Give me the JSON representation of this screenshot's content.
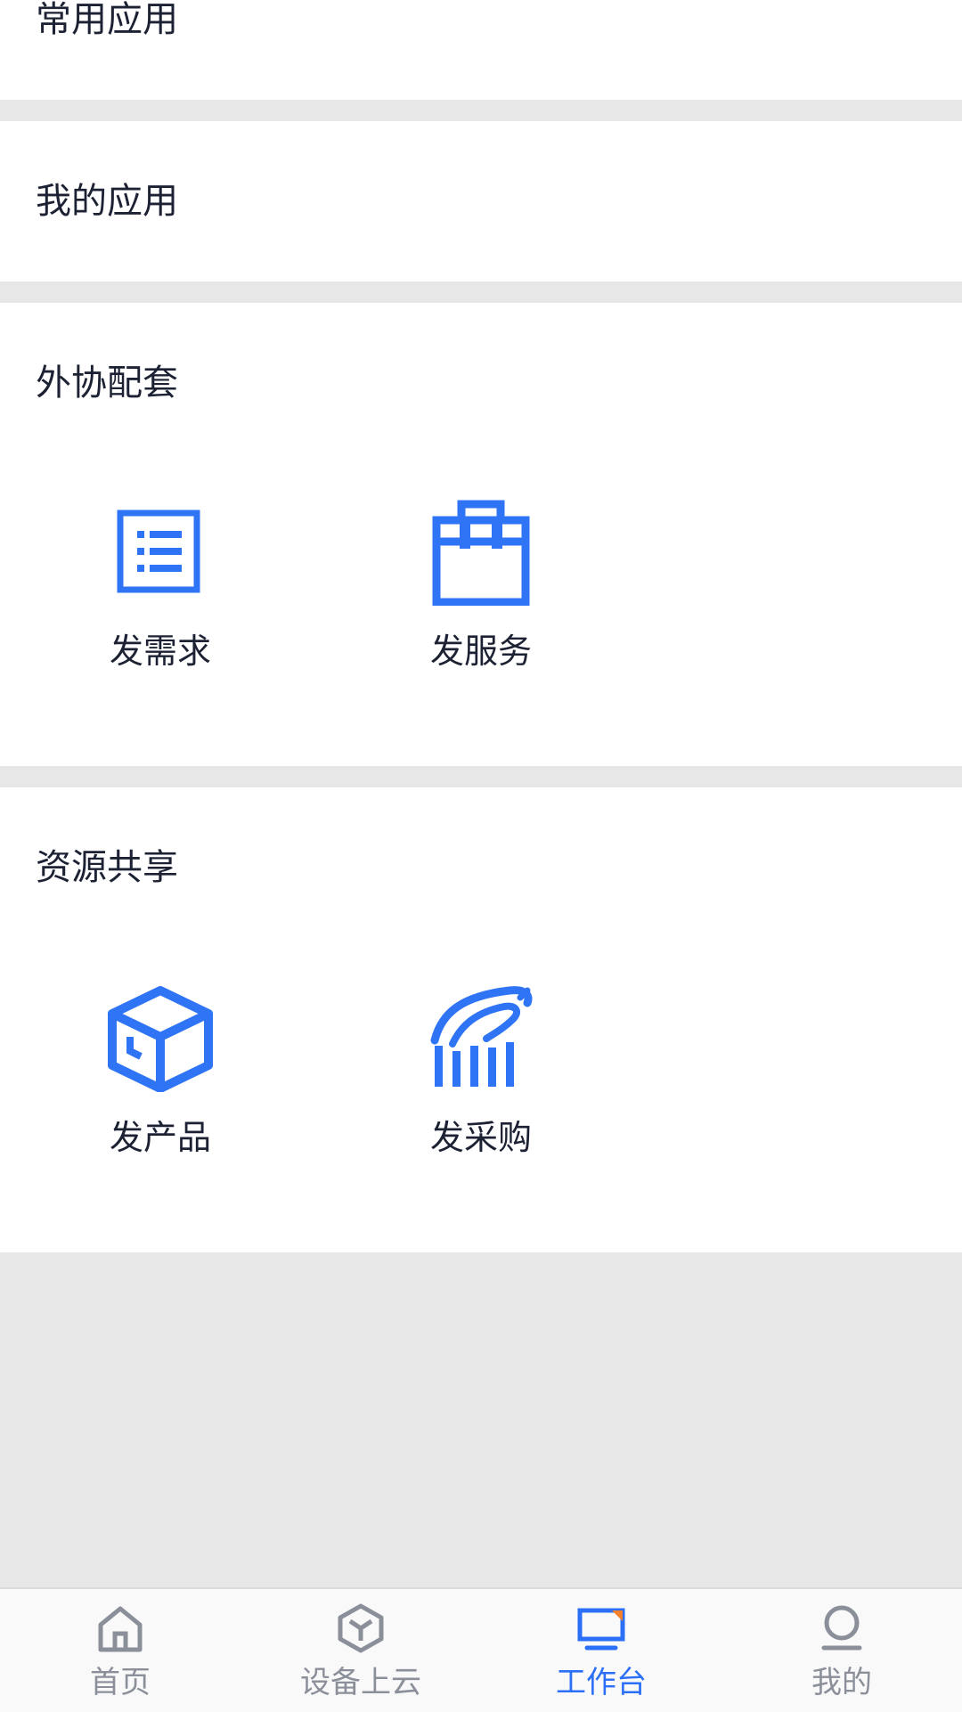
{
  "sections": {
    "common": {
      "title": "常用应用"
    },
    "mine": {
      "title": "我的应用"
    },
    "outsourcing": {
      "title": "外协配套",
      "items": [
        {
          "label": "发需求",
          "icon": "list-document-icon"
        },
        {
          "label": "发服务",
          "icon": "toolbox-icon"
        }
      ]
    },
    "resources": {
      "title": "资源共享",
      "items": [
        {
          "label": "发产品",
          "icon": "cube-box-icon"
        },
        {
          "label": "发采购",
          "icon": "hand-purchase-icon"
        }
      ]
    }
  },
  "tabbar": {
    "tabs": [
      {
        "label": "首页",
        "icon": "home-icon"
      },
      {
        "label": "设备上云",
        "icon": "cloud-cube-icon"
      },
      {
        "label": "工作台",
        "icon": "workbench-monitor-icon",
        "active": true
      },
      {
        "label": "我的",
        "icon": "user-icon"
      }
    ]
  },
  "colors": {
    "accent": "#2a6ff6",
    "icon_blue": "#2f74f5",
    "text": "#1c2233",
    "tab_inactive": "#8a8f99",
    "divider": "#e7e7e7",
    "badge_orange": "#f5822a"
  }
}
